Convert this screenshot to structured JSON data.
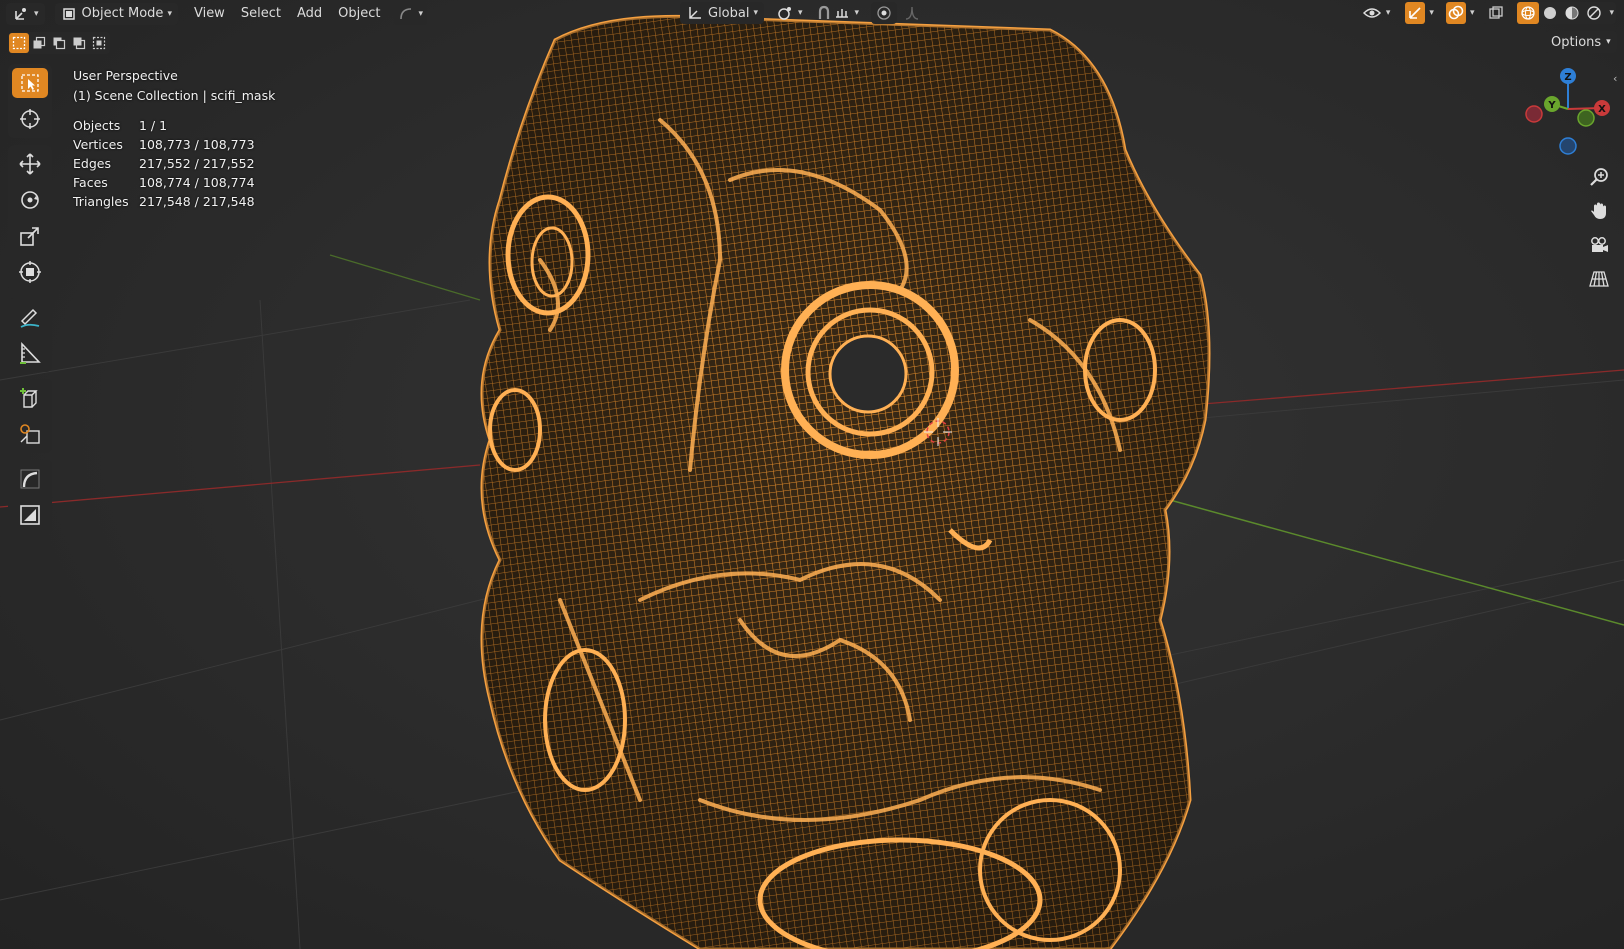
{
  "header": {
    "mode_label": "Object Mode",
    "menus": [
      "View",
      "Select",
      "Add",
      "Object"
    ],
    "orientation_label": "Global"
  },
  "options_label": "Options",
  "overlay": {
    "view_name": "User Perspective",
    "collection_info": "(1) Scene Collection | scifi_mask",
    "stats": [
      {
        "label": "Objects",
        "value": "1 / 1"
      },
      {
        "label": "Vertices",
        "value": "108,773 / 108,773"
      },
      {
        "label": "Edges",
        "value": "217,552 / 217,552"
      },
      {
        "label": "Faces",
        "value": "108,774 / 108,774"
      },
      {
        "label": "Triangles",
        "value": "217,548 / 217,548"
      }
    ]
  },
  "gizmo": {
    "z": "Z",
    "y": "Y",
    "x": "X"
  },
  "toolbar": {
    "tools": [
      "select-box",
      "cursor",
      "move",
      "rotate",
      "scale",
      "transform",
      "annotate",
      "measure",
      "add-cube",
      "add-object",
      "spin",
      "shrink"
    ],
    "active": "select-box"
  },
  "colors": {
    "wire": "#f0942e",
    "accent": "#e08722",
    "x_axis": "#c93a3a",
    "y_axis": "#6aa62d",
    "z_axis": "#2e7fd6"
  },
  "icons": [
    "editor-type-icon",
    "object-mode-icon",
    "transform-pivot-icon",
    "snap-icon",
    "proportional-icon",
    "visibility-icon",
    "gizmo-icon",
    "overlay-icon",
    "xray-icon",
    "wireframe-shading-icon",
    "solid-shading-icon",
    "material-shading-icon",
    "rendered-shading-icon",
    "zoom-icon",
    "hand-icon",
    "camera-icon",
    "grid-icon"
  ]
}
